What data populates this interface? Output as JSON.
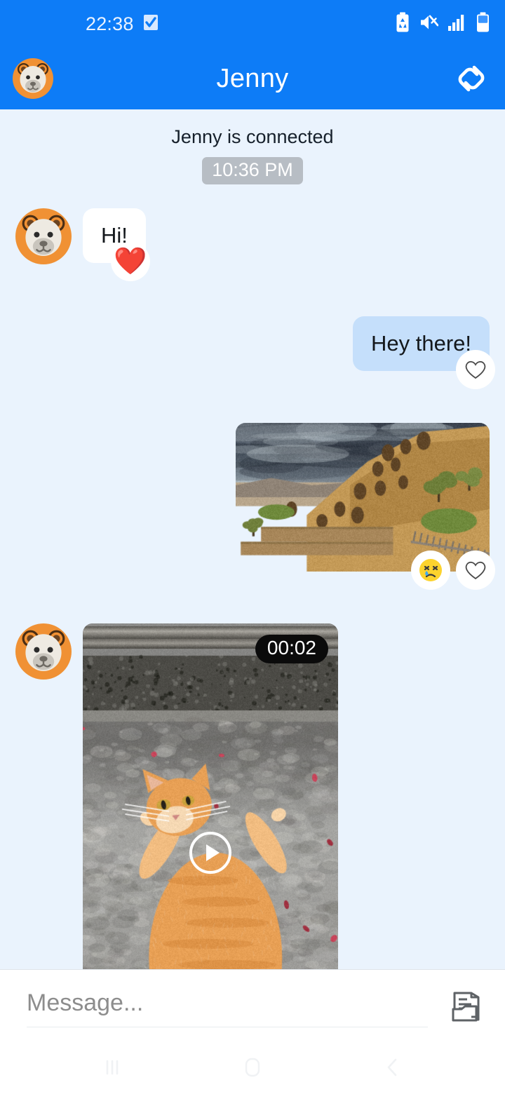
{
  "status_bar": {
    "time": "22:38",
    "left_icons": [
      {
        "name": "task-checkbox-icon",
        "label": "checkbox"
      }
    ],
    "right_icons": [
      {
        "name": "power-saving-battery-icon",
        "label": "power-saving"
      },
      {
        "name": "sound-muted-icon",
        "label": "muted"
      },
      {
        "name": "signal-bars-icon",
        "label": "signal"
      },
      {
        "name": "battery-icon",
        "label": "battery"
      }
    ]
  },
  "header": {
    "title": "Jenny",
    "avatar_name": "bear-avatar",
    "action_icon": "link-icon"
  },
  "chat": {
    "system_note": "Jenny is connected",
    "time_divider": "10:36 PM",
    "messages": [
      {
        "id": "msg-1",
        "direction": "incoming",
        "type": "text",
        "text": "Hi!",
        "avatar": "bear-avatar",
        "reactions": [
          {
            "name": "heart-filled-reaction",
            "glyph": "❤️"
          }
        ]
      },
      {
        "id": "msg-2",
        "direction": "outgoing",
        "type": "text",
        "text": "Hey there!",
        "reactions": [
          {
            "name": "heart-outline-reaction",
            "glyph": "♡"
          }
        ]
      },
      {
        "id": "msg-3",
        "direction": "outgoing",
        "type": "image",
        "alt": "cave monastery on a rocky hillside under stormy sky",
        "reactions": [
          {
            "name": "crying-face-reaction",
            "glyph": "😢"
          },
          {
            "name": "heart-outline-reaction",
            "glyph": "♡"
          }
        ]
      },
      {
        "id": "msg-4",
        "direction": "incoming",
        "type": "video",
        "alt": "orange cat lying on concrete pavement",
        "duration": "00:02",
        "avatar": "bear-avatar",
        "play_icon": "play-icon",
        "reactions": []
      }
    ]
  },
  "composer": {
    "placeholder": "Message...",
    "value": "",
    "attach_icon": "document-attachment-icon"
  },
  "nav_bar": {
    "buttons": [
      {
        "name": "recents-button",
        "icon": "recents-icon"
      },
      {
        "name": "home-button",
        "icon": "home-icon"
      },
      {
        "name": "back-button",
        "icon": "back-chevron-icon"
      }
    ]
  },
  "colors": {
    "header_blue": "#0d7cf7",
    "chat_background": "#eaf3fd",
    "incoming_bubble": "#ffffff",
    "outgoing_bubble": "#c5dffb",
    "time_chip": "#b7bdc4",
    "avatar_orange": "#f09134",
    "duration_chip": "#0b0b0b"
  }
}
